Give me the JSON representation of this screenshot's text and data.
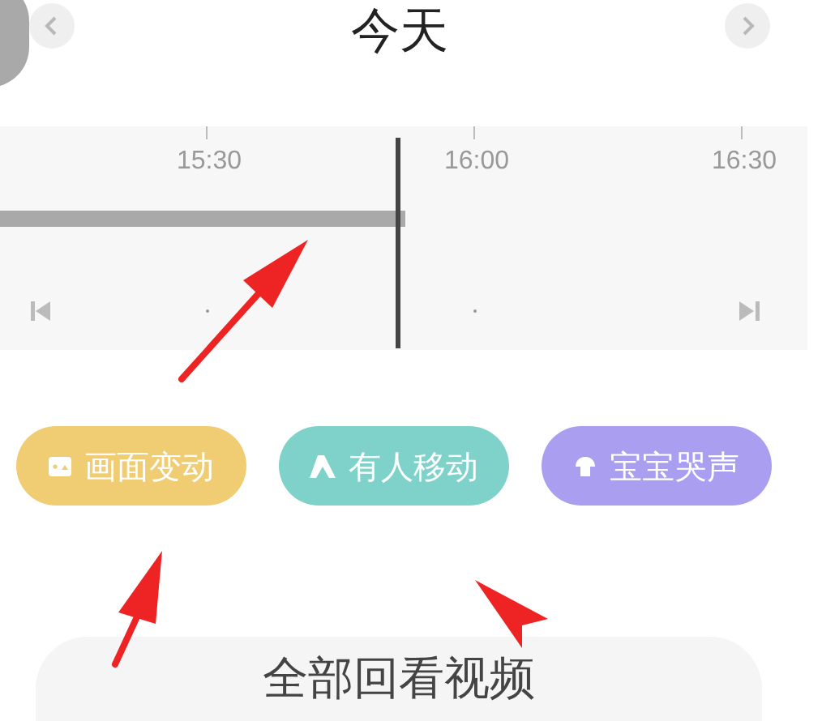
{
  "header": {
    "title": "今天"
  },
  "timeline": {
    "ticks": [
      "15:30",
      "16:00",
      "16:30"
    ]
  },
  "filters": [
    {
      "label": "画面变动",
      "kind": "image",
      "color": "#f0cd73"
    },
    {
      "label": "有人移动",
      "kind": "person",
      "color": "#7fd2ca"
    },
    {
      "label": "宝宝哭声",
      "kind": "baby",
      "color": "#a99ef0"
    }
  ],
  "bottom_button": {
    "label": "全部回看视频"
  }
}
